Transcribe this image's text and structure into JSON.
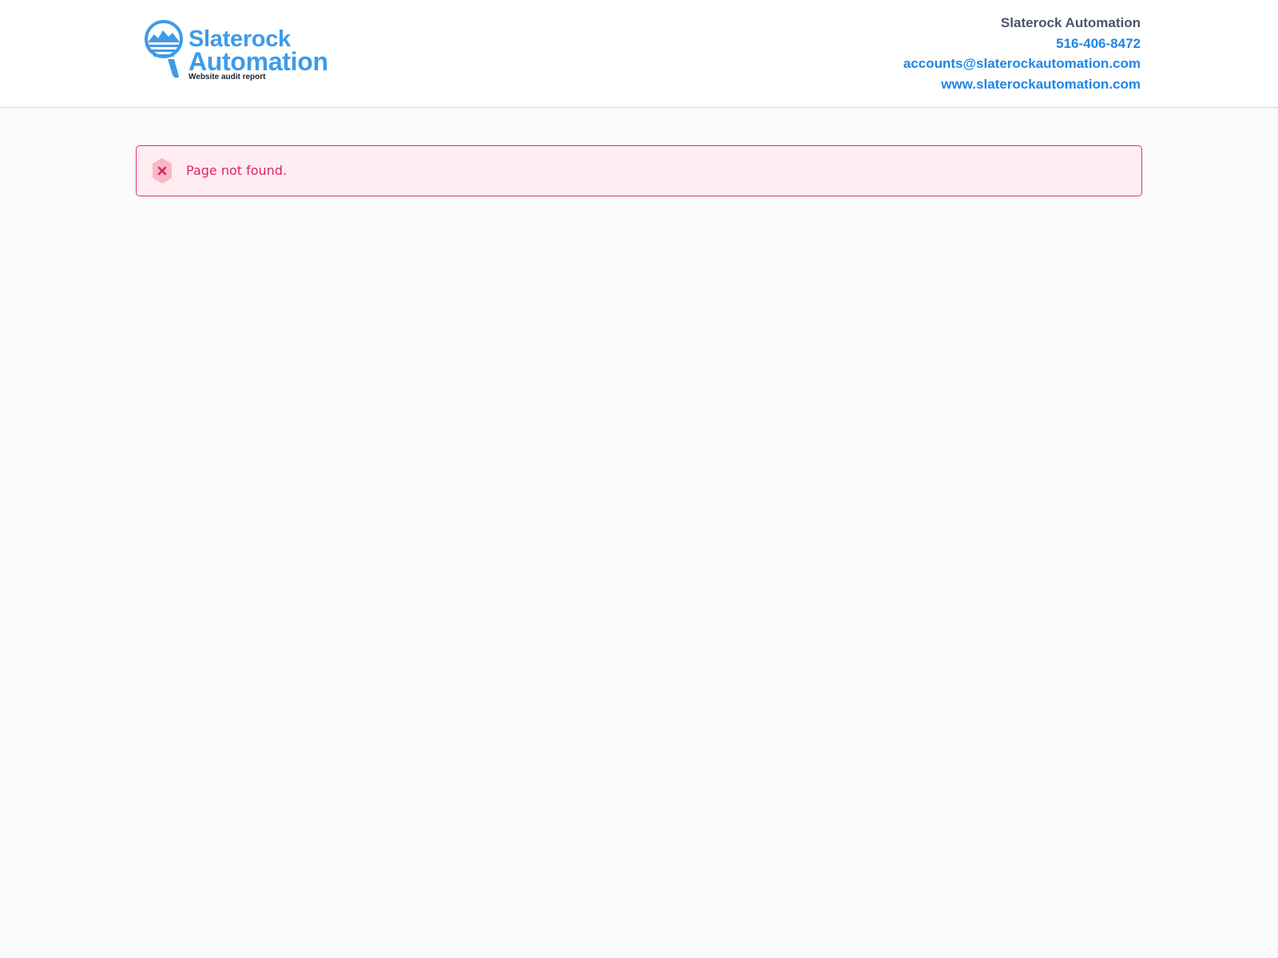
{
  "brand": {
    "name_line_1": "Slaterock",
    "name_line_2": "Automation",
    "tagline": "Website audit report",
    "logo_icon": "magnifier-mountain-icon",
    "color": "#3d9be9"
  },
  "contact": {
    "company": "Slaterock Automation",
    "phone": "516-406-8472",
    "email": "accounts@slaterockautomation.com",
    "website": "www.slaterockautomation.com",
    "link_color": "#1f86e6"
  },
  "alert": {
    "icon": "error-hexagon-icon",
    "message": "Page not found.",
    "text_color": "#e0245e",
    "background_color": "#ffedf2"
  }
}
